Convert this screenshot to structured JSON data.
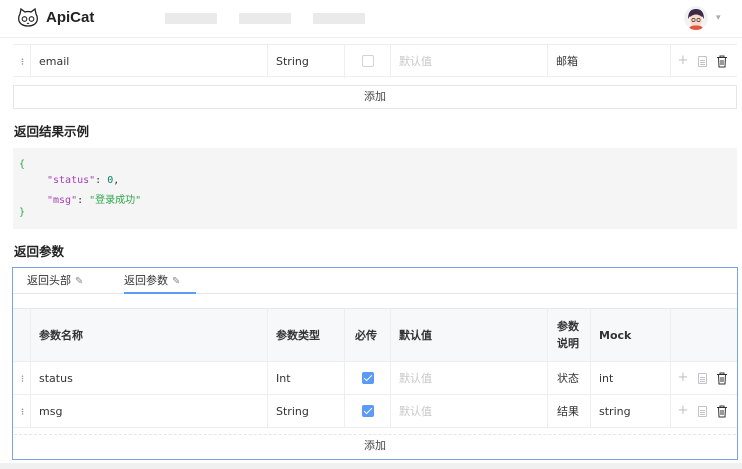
{
  "header": {
    "app_name": "ApiCat",
    "caret": "▾"
  },
  "top_table": {
    "rows": [
      {
        "name": "email",
        "type": "String",
        "required": false,
        "default_placeholder": "默认值",
        "description": "邮箱"
      }
    ],
    "add_label": "添加"
  },
  "example": {
    "title": "返回结果示例",
    "lines": [
      "{",
      "\"status\"",
      ": ",
      "0",
      ",",
      "\"msg\"",
      ": ",
      "\"登录成功\"",
      "}"
    ]
  },
  "response": {
    "title": "返回参数",
    "tabs": [
      {
        "label": "返回头部",
        "active": false
      },
      {
        "label": "返回参数",
        "active": true
      }
    ],
    "columns": {
      "name": "参数名称",
      "type": "参数类型",
      "required": "必传",
      "default": "默认值",
      "desc_line1": "参数",
      "desc_line2": "说明",
      "mock": "Mock"
    },
    "rows": [
      {
        "name": "status",
        "type": "Int",
        "required": true,
        "default_placeholder": "默认值",
        "description": "状态",
        "mock": "int"
      },
      {
        "name": "msg",
        "type": "String",
        "required": true,
        "default_placeholder": "默认值",
        "description": "结果",
        "mock": "string"
      }
    ],
    "add_label": "添加"
  },
  "icons": {
    "plus": "+",
    "pencil": "✎"
  },
  "colors": {
    "accent": "#5a9cf5",
    "panel_border": "#7aa3e5",
    "json_key": "#a43fb5",
    "json_string": "#2ba64a"
  }
}
